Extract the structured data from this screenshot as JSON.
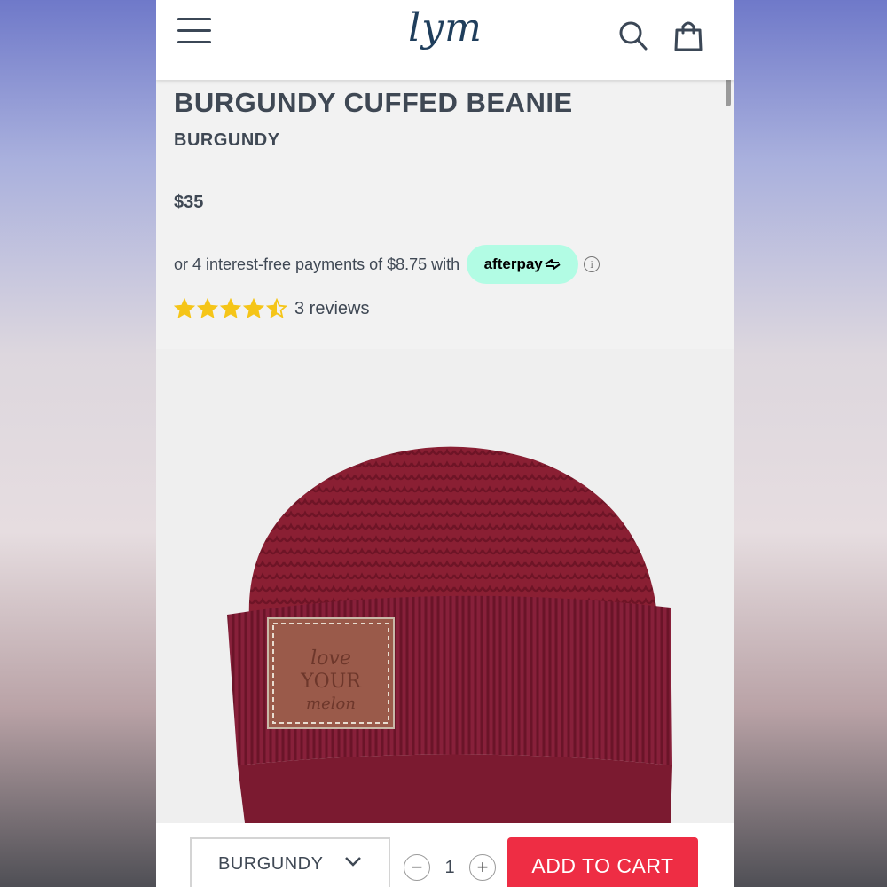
{
  "header": {
    "logo_text": "lym",
    "menu_icon": "hamburger-menu-icon",
    "search_icon": "search-icon",
    "cart_icon": "shopping-bag-icon"
  },
  "product": {
    "title": "BURGUNDY CUFFED BEANIE",
    "variant": "BURGUNDY",
    "price": "$35",
    "afterpay_text": "or 4 interest-free payments of $8.75 with",
    "afterpay_label": "afterpay",
    "rating": 4.5,
    "reviews_text": "3 reviews",
    "image": {
      "color": "#8a1f33",
      "patch_lines": [
        "love",
        "YOUR",
        "melon"
      ]
    }
  },
  "purchase_bar": {
    "variant_select": "BURGUNDY",
    "quantity": "1",
    "add_to_cart_label": "ADD TO CART"
  },
  "colors": {
    "accent_red": "#ee2d44",
    "afterpay_mint": "#b2fce4",
    "star_yellow": "#f5c518",
    "text_dark": "#3f4854"
  }
}
